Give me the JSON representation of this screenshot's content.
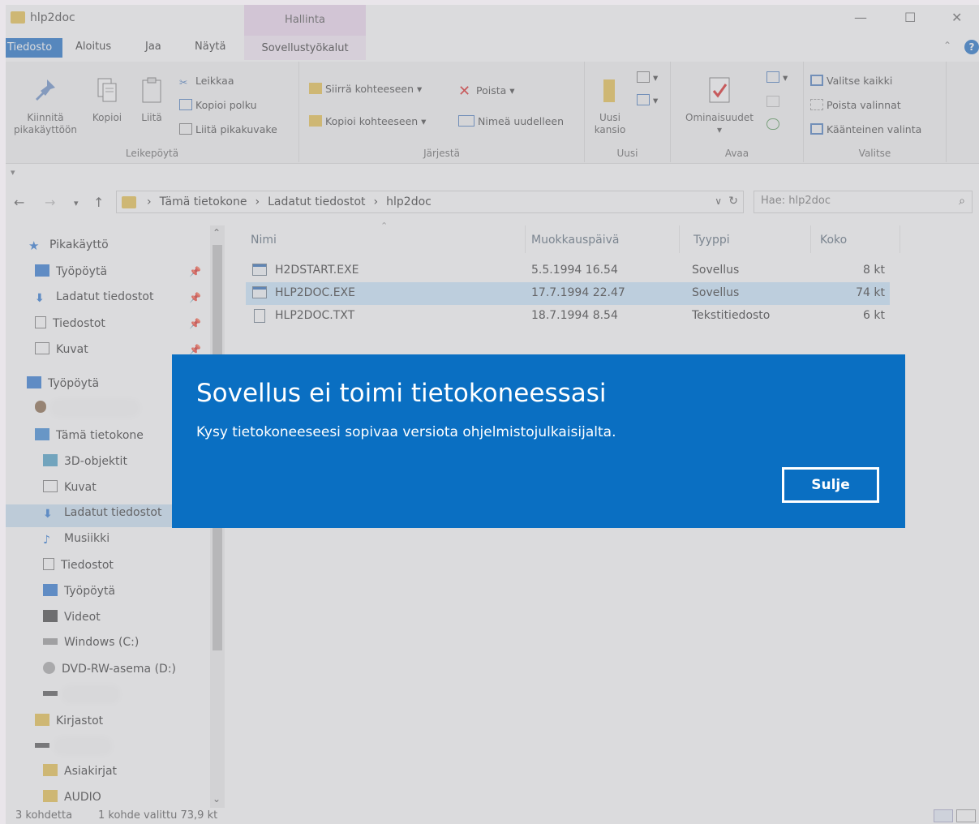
{
  "window": {
    "title": "hlp2doc",
    "context_group": "Hallinta"
  },
  "tabs": {
    "file": "Tiedosto",
    "home": "Aloitus",
    "share": "Jaa",
    "view": "Näytä",
    "app_tools": "Sovellustyökalut"
  },
  "ribbon": {
    "clipboard": {
      "label": "Leikepöytä",
      "pin": "Kiinnitä pikakäyttöön",
      "copy": "Kopioi",
      "paste": "Liitä",
      "cut": "Leikkaa",
      "copy_path": "Kopioi polku",
      "paste_shortcut": "Liitä pikakuvake"
    },
    "organize": {
      "label": "Järjestä",
      "move_to": "Siirrä kohteeseen ▾",
      "copy_to": "Kopioi kohteeseen ▾",
      "delete": "Poista ▾",
      "rename": "Nimeä uudelleen"
    },
    "new": {
      "label": "Uusi",
      "new_folder": "Uusi kansio"
    },
    "open": {
      "label": "Avaa",
      "properties": "Ominaisuudet"
    },
    "select": {
      "label": "Valitse",
      "select_all": "Valitse kaikki",
      "select_none": "Poista valinnat",
      "invert": "Käänteinen valinta"
    }
  },
  "address": {
    "crumbs": [
      "Tämä tietokone",
      "Ladatut tiedostot",
      "hlp2doc"
    ],
    "search_placeholder": "Hae: hlp2doc"
  },
  "nav": {
    "quick_access": "Pikakäyttö",
    "quick": [
      "Työpöytä",
      "Ladatut tiedostot",
      "Tiedostot",
      "Kuvat"
    ],
    "desktop": "Työpöytä",
    "this_pc": "Tämä tietokone",
    "pc_items": [
      "3D-objektit",
      "Kuvat",
      "Ladatut tiedostot",
      "Musiikki",
      "Tiedostot",
      "Työpöytä",
      "Videot",
      "Windows (C:)",
      "DVD-RW-asema (D:)"
    ],
    "libraries": "Kirjastot",
    "lib_items": [
      "Asiakirjat",
      "AUDIO"
    ]
  },
  "columns": {
    "name": "Nimi",
    "modified": "Muokkauspäivä",
    "type": "Tyyppi",
    "size": "Koko"
  },
  "files": [
    {
      "name": "H2DSTART.EXE",
      "modified": "5.5.1994 16.54",
      "type": "Sovellus",
      "size": "8 kt"
    },
    {
      "name": "HLP2DOC.EXE",
      "modified": "17.7.1994 22.47",
      "type": "Sovellus",
      "size": "74 kt"
    },
    {
      "name": "HLP2DOC.TXT",
      "modified": "18.7.1994 8.54",
      "type": "Tekstitiedosto",
      "size": "6 kt"
    }
  ],
  "status": {
    "count": "3 kohdetta",
    "selected": "1 kohde valittu  73,9 kt"
  },
  "dialog": {
    "title": "Sovellus ei toimi tietokoneessasi",
    "message": "Kysy tietokoneeseesi sopivaa versiota ohjelmistojulkaisijalta.",
    "close": "Sulje"
  },
  "colors": {
    "accent": "#1a6fc9",
    "dialog_bg": "#0a6fc2",
    "context_tab": "#f0d9f2"
  }
}
